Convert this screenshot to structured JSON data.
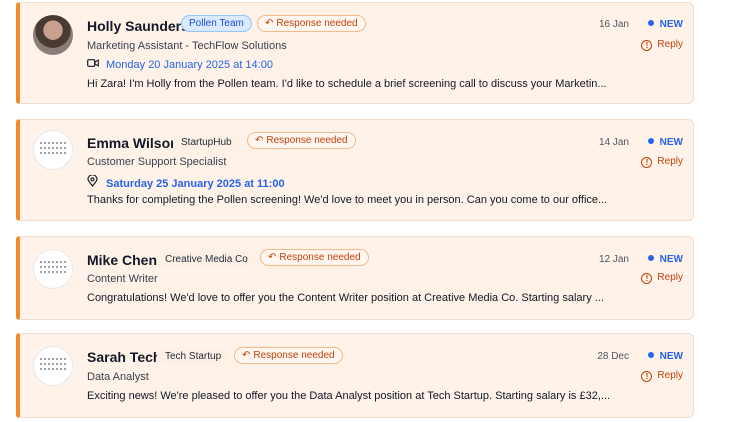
{
  "messages": [
    {
      "name": "Holly Saunders",
      "company": "Pollen Team",
      "response_badge": "Response needed",
      "date": "16 Jan",
      "new_label": "NEW",
      "reply_label": "Reply",
      "role": "Marketing Assistant - TechFlow Solutions",
      "event_icon": "video-icon",
      "event": "Monday 20 January 2025 at 14:00",
      "preview": "Hi Zara! I'm Holly from the Pollen team. I'd like to schedule a brief screening call to discuss your Marketin..."
    },
    {
      "name": "Emma Wilson",
      "company": "StartupHub",
      "response_badge": "Response needed",
      "date": "14 Jan",
      "new_label": "NEW",
      "reply_label": "Reply",
      "role": "Customer Support Specialist",
      "event_icon": "location-pin-icon",
      "event": "Saturday 25 January 2025 at 11:00",
      "preview": "Thanks for completing the Pollen screening! We'd love to meet you in person. Can you come to our office..."
    },
    {
      "name": "Mike Chen",
      "company": "Creative Media Co",
      "response_badge": "Response needed",
      "date": "12 Jan",
      "new_label": "NEW",
      "reply_label": "Reply",
      "role": "Content Writer",
      "preview": "Congratulations! We'd love to offer you the Content Writer position at Creative Media Co. Starting salary ..."
    },
    {
      "name": "Sarah Tech",
      "company": "Tech Startup",
      "response_badge": "Response needed",
      "date": "28 Dec",
      "new_label": "NEW",
      "reply_label": "Reply",
      "role": "Data Analyst",
      "preview": "Exciting news! We're pleased to offer you the Data Analyst position at Tech Startup. Starting salary is £32,..."
    }
  ],
  "colors": {
    "accent": "#f28a2e",
    "card_background": "#fff3e9",
    "link_blue": "#2563eb",
    "response_orange": "#c2410c"
  }
}
